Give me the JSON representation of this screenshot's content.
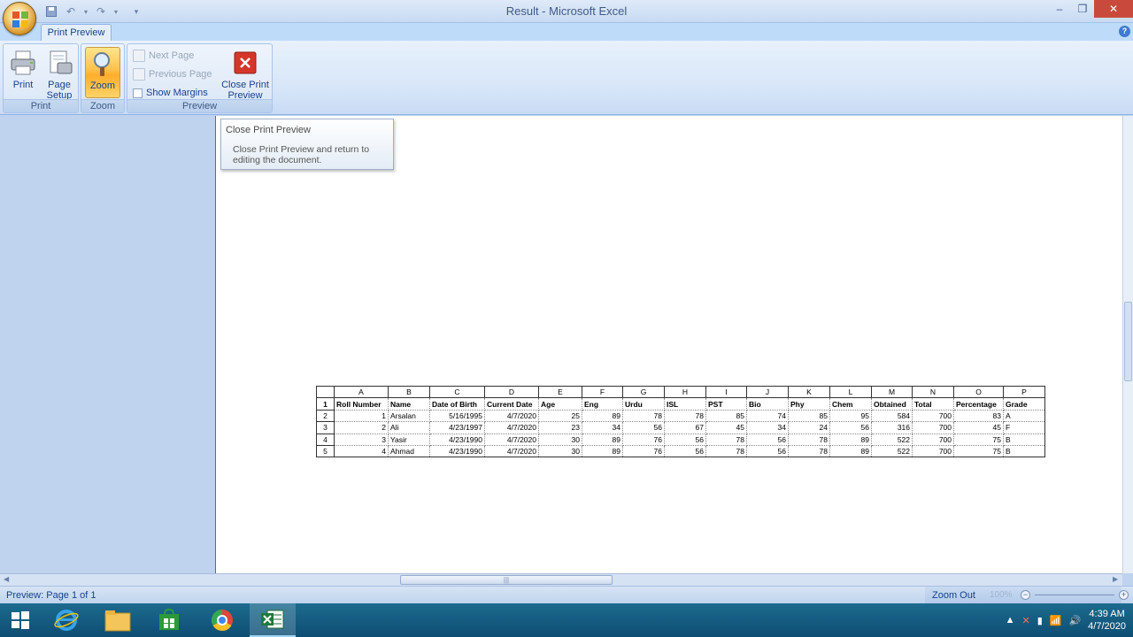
{
  "window": {
    "title": "Result - Microsoft Excel"
  },
  "tabs": {
    "active": "Print Preview"
  },
  "ribbon": {
    "groups": {
      "print": {
        "label": "Print",
        "print_label": "Print",
        "page_setup_label_1": "Page",
        "page_setup_label_2": "Setup"
      },
      "zoom": {
        "label": "Zoom",
        "zoom_label": "Zoom"
      },
      "preview": {
        "label": "Preview",
        "next_page": "Next Page",
        "previous_page": "Previous Page",
        "show_margins": "Show Margins",
        "close_label_1": "Close Print",
        "close_label_2": "Preview"
      }
    }
  },
  "tooltip": {
    "title": "Close Print Preview",
    "body_1": "Close Print Preview and return to",
    "body_2": "editing the document."
  },
  "sheet": {
    "column_letters": [
      "A",
      "B",
      "C",
      "D",
      "E",
      "F",
      "G",
      "H",
      "I",
      "J",
      "K",
      "L",
      "M",
      "N",
      "O",
      "P"
    ],
    "row_numbers": [
      "1",
      "2",
      "3",
      "4",
      "5"
    ],
    "headers": [
      "Roll Number",
      "Name",
      "Date of Birth",
      "Current Date",
      "Age",
      "Eng",
      "Urdu",
      "ISL",
      "PST",
      "Bio",
      "Phy",
      "Chem",
      "Obtained",
      "Total",
      "Percentage",
      "Grade"
    ],
    "rows": [
      [
        "1",
        "Arsalan",
        "5/16/1995",
        "4/7/2020",
        "25",
        "89",
        "78",
        "78",
        "85",
        "74",
        "85",
        "95",
        "584",
        "700",
        "83",
        "A"
      ],
      [
        "2",
        "Ali",
        "4/23/1997",
        "4/7/2020",
        "23",
        "34",
        "56",
        "67",
        "45",
        "34",
        "24",
        "56",
        "316",
        "700",
        "45",
        "F"
      ],
      [
        "3",
        "Yasir",
        "4/23/1990",
        "4/7/2020",
        "30",
        "89",
        "76",
        "56",
        "78",
        "56",
        "78",
        "89",
        "522",
        "700",
        "75",
        "B"
      ],
      [
        "4",
        "Ahmad",
        "4/23/1990",
        "4/7/2020",
        "30",
        "89",
        "76",
        "56",
        "78",
        "56",
        "78",
        "89",
        "522",
        "700",
        "75",
        "B"
      ]
    ]
  },
  "statusbar": {
    "text": "Preview: Page 1 of 1",
    "zoom_out": "Zoom Out",
    "zoom_pct": "100%"
  },
  "taskbar": {
    "time": "4:39 AM",
    "date": "4/7/2020"
  },
  "colors": {
    "ribbon_bg": "#dae6f6",
    "zoom_active": "#ffc14a",
    "close_red": "#c94a3d",
    "taskbar": "#0e4d73"
  }
}
